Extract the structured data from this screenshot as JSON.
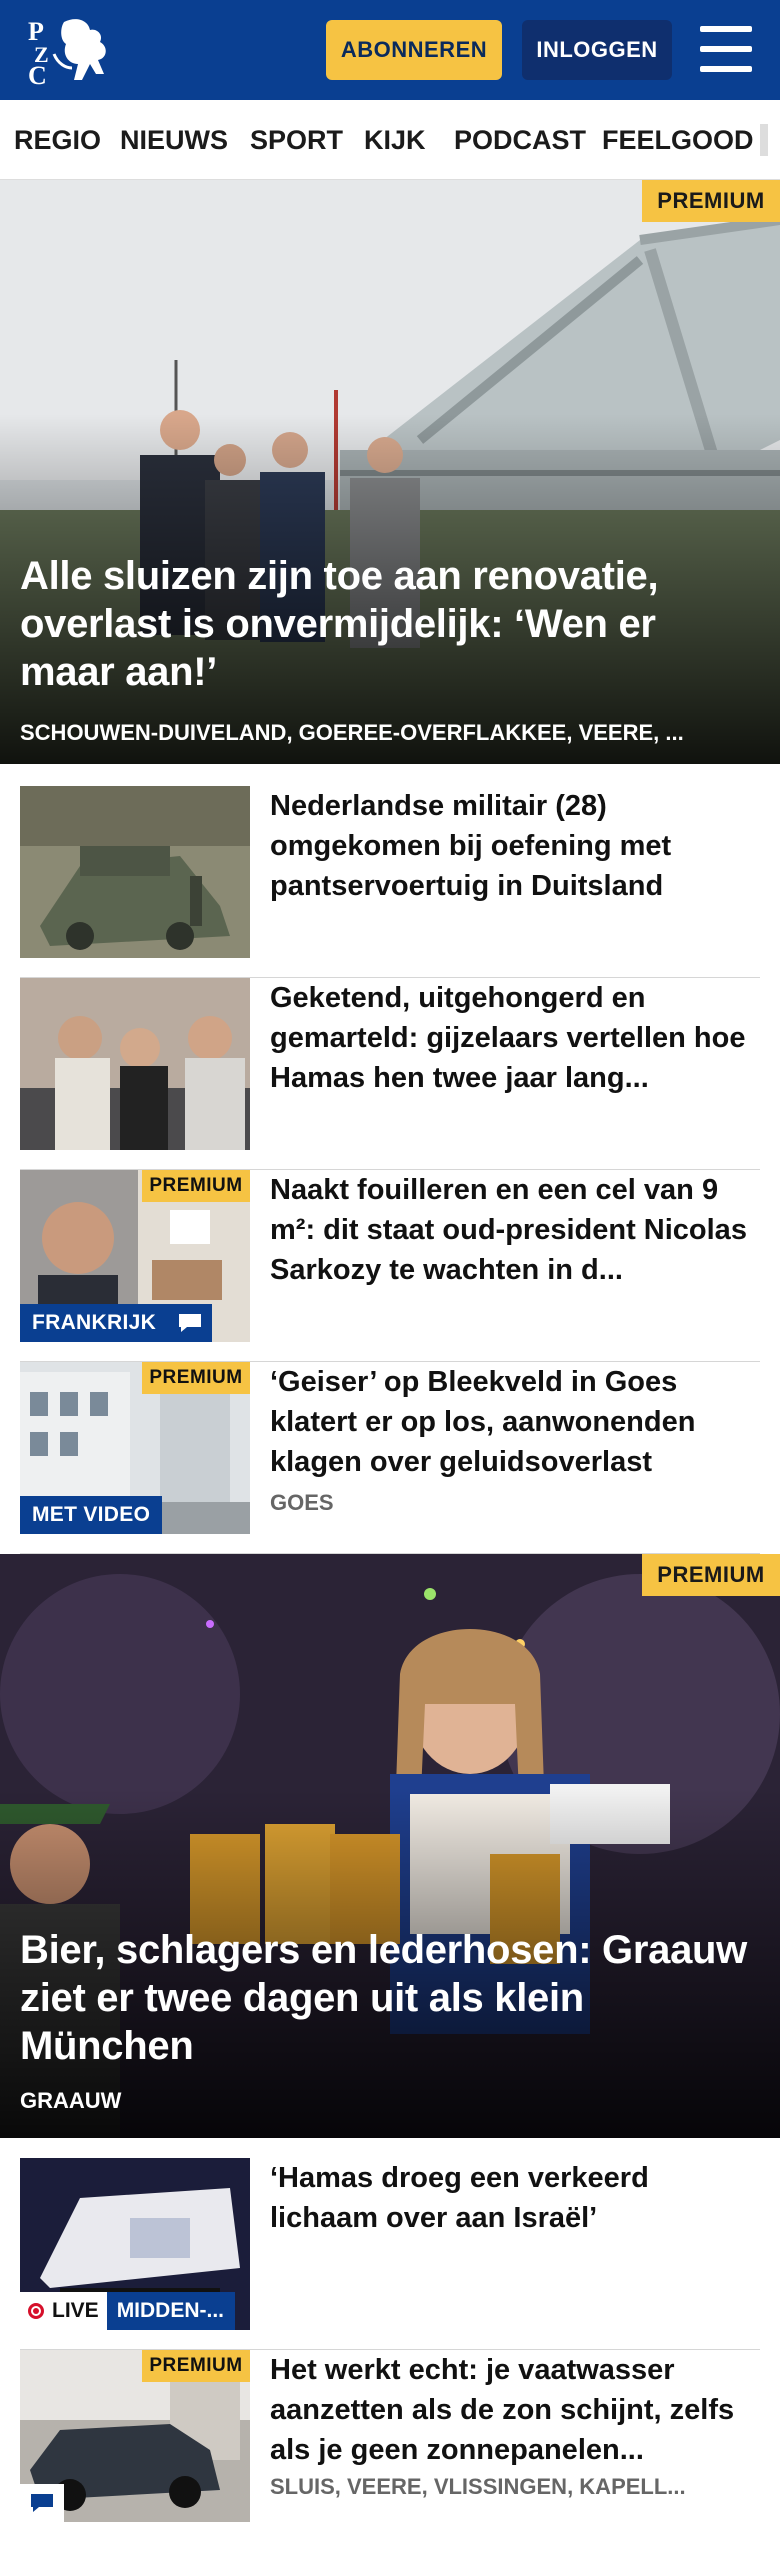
{
  "header": {
    "logo_text": "PZC",
    "subscribe_label": "ABONNEREN",
    "login_label": "INLOGGEN",
    "colors": {
      "brand": "#0a3f91",
      "accent": "#f6c343"
    }
  },
  "nav": {
    "items": [
      "REGIO",
      "NIEUWS",
      "SPORT",
      "KIJK",
      "PODCAST",
      "FEELGOOD"
    ]
  },
  "hero1": {
    "badge": "PREMIUM",
    "title": "Alle sluizen zijn toe aan renovatie, overlast is onvermijdelijk: ‘Wen er maar aan!’",
    "meta": "SCHOUWEN-DUIVELAND, GOEREE-OVERFLAKKEE, VEERE, ..."
  },
  "articles1": [
    {
      "title": "Nederlandse militair (28) omgekomen bij oefening met pantservoertuig in Duitsland"
    },
    {
      "title": "Geketend, uitgehongerd en gemarteld: gijzelaars vertellen hoe Hamas hen twee jaar lang..."
    },
    {
      "title": "Naakt fouilleren en een cel van 9 m²: dit staat oud-president Nicolas Sarkozy te wachten in d...",
      "badge": "PREMIUM",
      "section": "FRANKRIJK"
    },
    {
      "title": "‘Geiser’ op Bleekveld in Goes klatert er op los, aanwonenden klagen over geluidsoverlast",
      "badge": "PREMIUM",
      "section": "MET VIDEO",
      "meta": "GOES"
    }
  ],
  "hero2": {
    "badge": "PREMIUM",
    "title": "Bier, schlagers en lederhosen: Graauw ziet er twee dagen uit als klein München",
    "meta": "GRAAUW"
  },
  "articles2": [
    {
      "title": "‘Hamas droeg een verkeerd lichaam over aan Israël’",
      "live": "LIVE",
      "section": "MIDDEN-..."
    },
    {
      "title": "Het werkt echt: je vaatwasser aanzetten als de zon schijnt, zelfs als je geen zonnepanelen...",
      "badge": "PREMIUM",
      "meta": "SLUIS, VEERE, VLISSINGEN, KAPELL..."
    }
  ]
}
